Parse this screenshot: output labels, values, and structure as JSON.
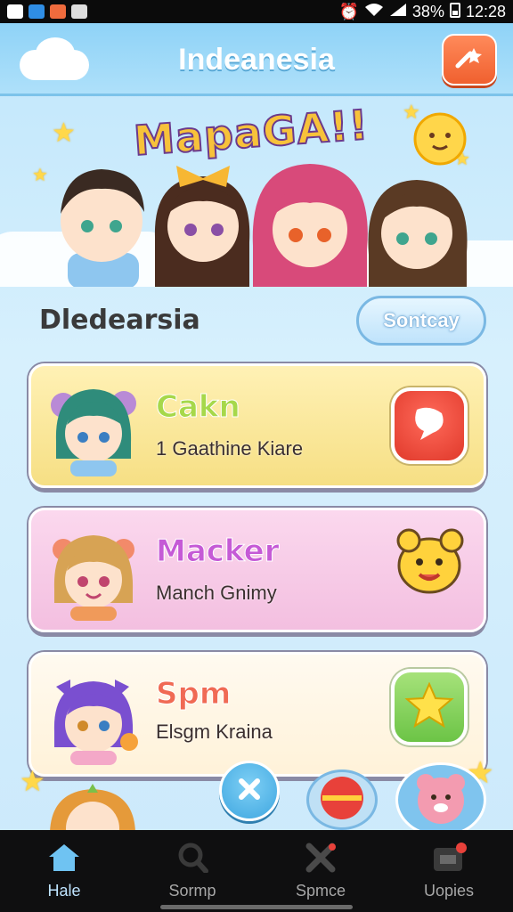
{
  "status_bar": {
    "time": "12:28",
    "battery": "38%",
    "icons": [
      "notification-icon",
      "app-icon-blue",
      "app-icon-orange",
      "gallery-icon",
      "alarm-icon",
      "wifi-icon",
      "signal-icon",
      "battery-icon"
    ]
  },
  "header": {
    "title": "Indeanesia",
    "action_icon": "wand-icon"
  },
  "hero": {
    "title": "MapaGA!!"
  },
  "section": {
    "title": "Dledearsia",
    "button_label": "Sontcay"
  },
  "cards": [
    {
      "title": "Cakn",
      "subtitle": "1 Gaathine Kiare",
      "title_color": "#a6d84a",
      "bg": "#fbe89a",
      "button_icon": "chat-bubble-icon",
      "button_color": "#ef4b3b"
    },
    {
      "title": "Macker",
      "subtitle": "Manch Gnimy",
      "title_color": "#c55ad6",
      "bg": "#f7c9e4",
      "button_icon": "mascot-icon",
      "button_color": "#ffd23c"
    },
    {
      "title": "Spm",
      "subtitle": "Elsgm Kraina",
      "title_color": "#f06a54",
      "bg": "#fff6e2",
      "button_icon": "star-icon",
      "button_color": "#8ed764"
    }
  ],
  "bottom_nav": [
    {
      "label": "Hale",
      "icon": "home-icon",
      "active": true
    },
    {
      "label": "Sormp",
      "icon": "search-icon",
      "active": false
    },
    {
      "label": "Spmce",
      "icon": "close-icon",
      "active": false
    },
    {
      "label": "Uopies",
      "icon": "inbox-icon",
      "active": false
    }
  ],
  "colors": {
    "accent": "#8fd3f7",
    "header_action": "#f0602f",
    "nav_bg": "#0f0f10"
  }
}
